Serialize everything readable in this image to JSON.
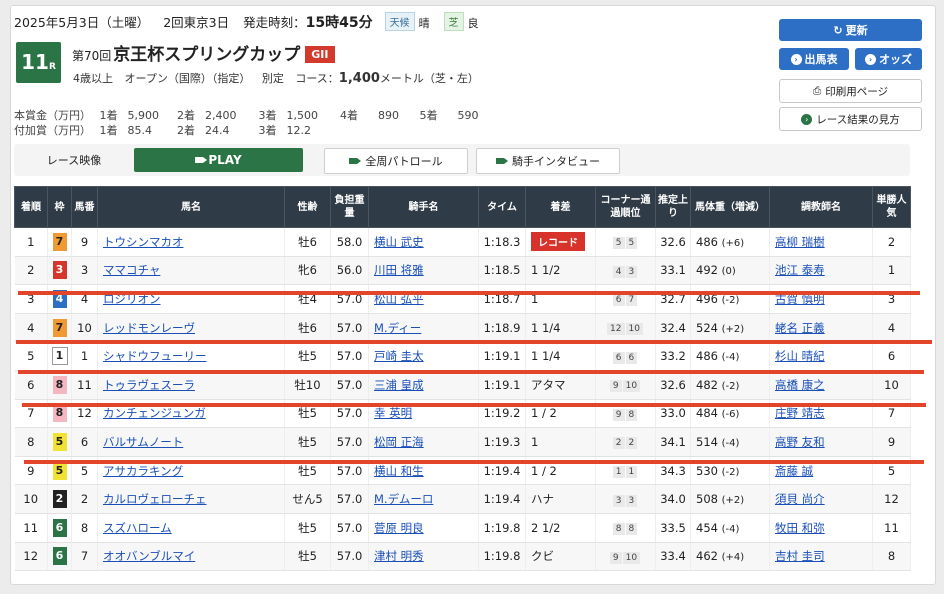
{
  "header": {
    "date": "2025年5月3日（土曜）",
    "meeting": "2回東京3日",
    "post_time_label": "発走時刻：",
    "post_time": "15時45分",
    "weather_label": "天候",
    "weather": "晴",
    "track_label": "芝",
    "track_condition": "良",
    "race_number": "11",
    "race_number_suffix": "R",
    "edition": "第70回",
    "race_name": "京王杯スプリングカップ",
    "grade": "GII",
    "conditions_1": "4歳以上",
    "conditions_2": "オープン（国際）（指定）",
    "conditions_3": "別定",
    "course_label": "コース：",
    "distance": "1,400",
    "distance_unit": "メートル（芝・左）"
  },
  "prize": {
    "main_label": "本賞金（万円）",
    "main": [
      {
        "place": "1着",
        "amount": "5,900"
      },
      {
        "place": "2着",
        "amount": "2,400"
      },
      {
        "place": "3着",
        "amount": "1,500"
      },
      {
        "place": "4着",
        "amount": "890"
      },
      {
        "place": "5着",
        "amount": "590"
      }
    ],
    "extra_label": "付加賞（万円）",
    "extra": [
      {
        "place": "1着",
        "amount": "85.4"
      },
      {
        "place": "2着",
        "amount": "24.4"
      },
      {
        "place": "3着",
        "amount": "12.2"
      }
    ]
  },
  "buttons": {
    "refresh": "更新",
    "entries": "出馬表",
    "odds": "オッズ",
    "print": "印刷用ページ",
    "howto": "レース結果の見方"
  },
  "video": {
    "label": "レース映像",
    "play": "PLAY",
    "patrol": "全周パトロール",
    "interview": "騎手インタビュー"
  },
  "columns": [
    "着順",
    "枠",
    "馬番",
    "馬名",
    "性齢",
    "負担重量",
    "騎手名",
    "タイム",
    "着差",
    "コーナー通過順位",
    "推定上り",
    "馬体重（増減）",
    "調教師名",
    "単勝人気"
  ],
  "waku_colors": {
    "1": {
      "bg": "#ffffff",
      "fg": "#222222"
    },
    "2": {
      "bg": "#222222",
      "fg": "#ffffff"
    },
    "3": {
      "bg": "#d5362c",
      "fg": "#ffffff"
    },
    "4": {
      "bg": "#2d6fc4",
      "fg": "#ffffff"
    },
    "5": {
      "bg": "#f2e236",
      "fg": "#222222"
    },
    "6": {
      "bg": "#2a7445",
      "fg": "#ffffff"
    },
    "7": {
      "bg": "#f09a34",
      "fg": "#222222"
    },
    "8": {
      "bg": "#f4b7c2",
      "fg": "#222222"
    }
  },
  "rows": [
    {
      "pos": "1",
      "waku": "7",
      "num": "9",
      "horse": "トウシンマカオ",
      "sexage": "牡6",
      "weight": "58.0",
      "jockey": "横山 武史",
      "time": "1:18.3",
      "margin": "",
      "record": "レコード",
      "corners": [
        "5",
        "5"
      ],
      "last3f": "32.6",
      "bw": "486",
      "bwd": "(+6)",
      "trainer": "高柳 瑞樹",
      "pop": "2"
    },
    {
      "pos": "2",
      "waku": "3",
      "num": "3",
      "horse": "ママコチャ",
      "sexage": "牝6",
      "weight": "56.0",
      "jockey": "川田 将雅",
      "time": "1:18.5",
      "margin": "1 1/2",
      "record": "",
      "corners": [
        "4",
        "3"
      ],
      "last3f": "33.1",
      "bw": "492",
      "bwd": "(0)",
      "trainer": "池江 泰寿",
      "pop": "1"
    },
    {
      "pos": "3",
      "waku": "4",
      "num": "4",
      "horse": "ロジリオン",
      "sexage": "牡4",
      "weight": "57.0",
      "jockey": "松山 弘平",
      "time": "1:18.7",
      "margin": "1",
      "record": "",
      "corners": [
        "6",
        "7"
      ],
      "last3f": "32.7",
      "bw": "496",
      "bwd": "(-2)",
      "trainer": "古賀 慎明",
      "pop": "3"
    },
    {
      "pos": "4",
      "waku": "7",
      "num": "10",
      "horse": "レッドモンレーヴ",
      "sexage": "牡6",
      "weight": "57.0",
      "jockey": "M.ディー",
      "time": "1:18.9",
      "margin": "1 1/4",
      "record": "",
      "corners": [
        "12",
        "10"
      ],
      "last3f": "32.4",
      "bw": "524",
      "bwd": "(+2)",
      "trainer": "蛯名 正義",
      "pop": "4"
    },
    {
      "pos": "5",
      "waku": "1",
      "num": "1",
      "horse": "シャドウフューリー",
      "sexage": "牡5",
      "weight": "57.0",
      "jockey": "戸崎 圭太",
      "time": "1:19.1",
      "margin": "1 1/4",
      "record": "",
      "corners": [
        "6",
        "6"
      ],
      "last3f": "33.2",
      "bw": "486",
      "bwd": "(-4)",
      "trainer": "杉山 晴紀",
      "pop": "6"
    },
    {
      "pos": "6",
      "waku": "8",
      "num": "11",
      "horse": "トゥラヴェスーラ",
      "sexage": "牡10",
      "weight": "57.0",
      "jockey": "三浦 皇成",
      "time": "1:19.1",
      "margin": "アタマ",
      "record": "",
      "corners": [
        "9",
        "10"
      ],
      "last3f": "32.6",
      "bw": "482",
      "bwd": "(-2)",
      "trainer": "高橋 康之",
      "pop": "10"
    },
    {
      "pos": "7",
      "waku": "8",
      "num": "12",
      "horse": "カンチェンジュンガ",
      "sexage": "牡5",
      "weight": "57.0",
      "jockey": "幸 英明",
      "time": "1:19.2",
      "margin": "1 / 2",
      "record": "",
      "corners": [
        "9",
        "8"
      ],
      "last3f": "33.0",
      "bw": "484",
      "bwd": "(-6)",
      "trainer": "庄野 靖志",
      "pop": "7"
    },
    {
      "pos": "8",
      "waku": "5",
      "num": "6",
      "horse": "バルサムノート",
      "sexage": "牡5",
      "weight": "57.0",
      "jockey": "松岡 正海",
      "time": "1:19.3",
      "margin": "1",
      "record": "",
      "corners": [
        "2",
        "2"
      ],
      "last3f": "34.1",
      "bw": "514",
      "bwd": "(-4)",
      "trainer": "高野 友和",
      "pop": "9"
    },
    {
      "pos": "9",
      "waku": "5",
      "num": "5",
      "horse": "アサカラキング",
      "sexage": "牡5",
      "weight": "57.0",
      "jockey": "横山 和生",
      "time": "1:19.4",
      "margin": "1 / 2",
      "record": "",
      "corners": [
        "1",
        "1"
      ],
      "last3f": "34.3",
      "bw": "530",
      "bwd": "(-2)",
      "trainer": "斎藤 誠",
      "pop": "5"
    },
    {
      "pos": "10",
      "waku": "2",
      "num": "2",
      "horse": "カルロヴェローチェ",
      "sexage": "せん5",
      "weight": "57.0",
      "jockey": "M.デムーロ",
      "time": "1:19.4",
      "margin": "ハナ",
      "record": "",
      "corners": [
        "3",
        "3"
      ],
      "last3f": "34.0",
      "bw": "508",
      "bwd": "(+2)",
      "trainer": "須貝 尚介",
      "pop": "12"
    },
    {
      "pos": "11",
      "waku": "6",
      "num": "8",
      "horse": "スズハローム",
      "sexage": "牡5",
      "weight": "57.0",
      "jockey": "菅原 明良",
      "time": "1:19.8",
      "margin": "2 1/2",
      "record": "",
      "corners": [
        "8",
        "8"
      ],
      "last3f": "33.5",
      "bw": "454",
      "bwd": "(-4)",
      "trainer": "牧田 和弥",
      "pop": "11"
    },
    {
      "pos": "12",
      "waku": "6",
      "num": "7",
      "horse": "オオバンブルマイ",
      "sexage": "牡5",
      "weight": "57.0",
      "jockey": "津村 明秀",
      "time": "1:19.8",
      "margin": "クビ",
      "record": "",
      "corners": [
        "9",
        "10"
      ],
      "last3f": "33.4",
      "bw": "462",
      "bwd": "(+4)",
      "trainer": "吉村 圭司",
      "pop": "8"
    }
  ],
  "annotation_color": "#e2452a"
}
